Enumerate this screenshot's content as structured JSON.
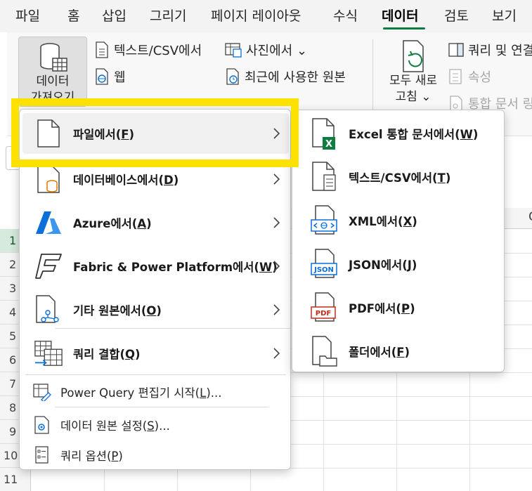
{
  "tabs": [
    {
      "label": "파일"
    },
    {
      "label": "홈"
    },
    {
      "label": "삽입"
    },
    {
      "label": "그리기"
    },
    {
      "label": "페이지 레이아웃"
    },
    {
      "label": "수식"
    },
    {
      "label": "데이터"
    },
    {
      "label": "검토"
    },
    {
      "label": "보기"
    }
  ],
  "ribbon": {
    "get_data": {
      "line1": "데이터",
      "line2": "가져오기"
    },
    "from_text_csv": "텍스트/CSV에서",
    "from_web": "웹",
    "from_picture": "사진에서 ⌄",
    "recent_sources": "최근에 사용한 원본",
    "refresh_all": {
      "line1": "모두 새로",
      "line2": "고침 ⌄"
    },
    "queries_connections": "쿼리 및 연결",
    "properties": "속성",
    "edit_links": "통합 문서 링"
  },
  "grid": {
    "column_label": "G",
    "rows": [
      "1",
      "2",
      "3",
      "4",
      "5",
      "6",
      "7",
      "8",
      "9",
      "10",
      "11"
    ]
  },
  "main_menu": {
    "items": [
      {
        "label": "파일에서(",
        "key": "F",
        "tail": ")"
      },
      {
        "label": "데이터베이스에서(",
        "key": "D",
        "tail": ")"
      },
      {
        "label": "Azure에서(",
        "key": "A",
        "tail": ")"
      },
      {
        "label": "Fabric & Power Platform에서(",
        "key": "W",
        "tail": ")"
      },
      {
        "label": "기타 원본에서(",
        "key": "O",
        "tail": ")"
      },
      {
        "label": "쿼리 결합(",
        "key": "Q",
        "tail": ")"
      }
    ],
    "plain_items": [
      {
        "label": "Power Query 편집기 시작(",
        "key": "L",
        "tail": ")..."
      },
      {
        "label": "데이터 원본 설정(",
        "key": "S",
        "tail": ")..."
      },
      {
        "label": "쿼리 옵션(",
        "key": "P",
        "tail": ")"
      }
    ]
  },
  "sub_menu": {
    "items": [
      {
        "label": "Excel 통합 문서에서(",
        "key": "W",
        "tail": ")"
      },
      {
        "label": "텍스트/CSV에서(",
        "key": "T",
        "tail": ")"
      },
      {
        "label": "XML에서(",
        "key": "X",
        "tail": ")"
      },
      {
        "label": "JSON에서(",
        "key": "J",
        "tail": ")"
      },
      {
        "label": "PDF에서(",
        "key": "P",
        "tail": ")"
      },
      {
        "label": "폴더에서(",
        "key": "F",
        "tail": ")"
      }
    ],
    "icon_text": {
      "json": "JSON",
      "pdf": "PDF",
      "excel": "X"
    }
  },
  "colors": {
    "accent": "#107c41",
    "highlight": "#fde100",
    "azure": "#0a6fd8",
    "pdf": "#c42b1c"
  }
}
